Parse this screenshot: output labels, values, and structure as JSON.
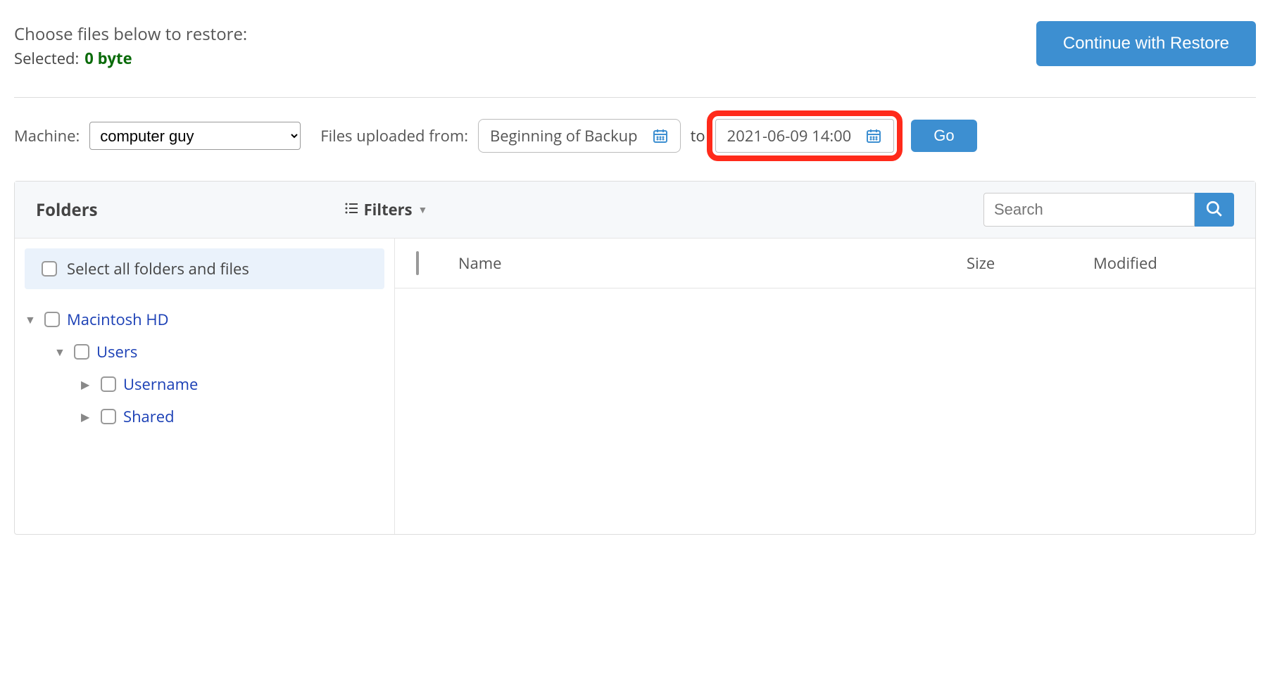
{
  "top": {
    "instruction": "Choose files below to restore:",
    "selected_label": "Selected:",
    "selected_value": "0 byte",
    "continue_button": "Continue with Restore"
  },
  "filters": {
    "machine_label": "Machine:",
    "machine_value": "computer guy",
    "uploaded_label": "Files uploaded from:",
    "from_value": "Beginning of Backup",
    "to_label": "to",
    "to_value": "2021-06-09 14:00",
    "go_button": "Go"
  },
  "panel": {
    "folders_title": "Folders",
    "filters_label": "Filters",
    "search_placeholder": "Search",
    "select_all_label": "Select all folders and files",
    "columns": {
      "name": "Name",
      "size": "Size",
      "modified": "Modified"
    }
  },
  "tree": [
    {
      "label": "Macintosh HD",
      "level": 0,
      "expanded": true
    },
    {
      "label": "Users",
      "level": 1,
      "expanded": true
    },
    {
      "label": "Username",
      "level": 2,
      "expanded": false
    },
    {
      "label": "Shared",
      "level": 2,
      "expanded": false
    }
  ]
}
